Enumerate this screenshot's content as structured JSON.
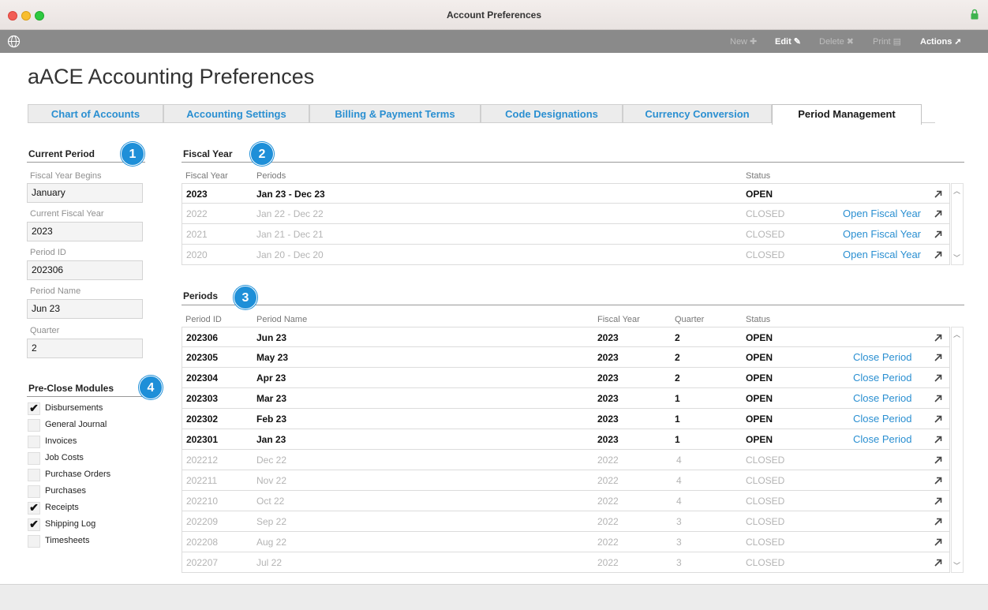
{
  "window": {
    "title": "Account Preferences"
  },
  "toolbar": {
    "new_label": "New",
    "edit_label": "Edit",
    "delete_label": "Delete",
    "print_label": "Print",
    "actions_label": "Actions",
    "icons": [
      "globe-icon",
      "plus-icon",
      "pencil-icon",
      "x-icon",
      "printer-icon",
      "goto-arrow-icon"
    ]
  },
  "page": {
    "title": "aACE Accounting Preferences"
  },
  "tabs": [
    {
      "label": "Chart of Accounts",
      "active": false
    },
    {
      "label": "Accounting Settings",
      "active": false
    },
    {
      "label": "Billing & Payment Terms",
      "active": false
    },
    {
      "label": "Code Designations",
      "active": false
    },
    {
      "label": "Currency Conversion",
      "active": false
    },
    {
      "label": "Period Management",
      "active": true
    }
  ],
  "badges": [
    "1",
    "2",
    "3",
    "4"
  ],
  "current_period": {
    "title": "Current Period",
    "fields": [
      {
        "label": "Fiscal Year Begins",
        "value": "January"
      },
      {
        "label": "Current Fiscal Year",
        "value": "2023"
      },
      {
        "label": "Period ID",
        "value": "202306"
      },
      {
        "label": "Period Name",
        "value": "Jun 23"
      },
      {
        "label": "Quarter",
        "value": "2"
      }
    ]
  },
  "pre_close": {
    "title": "Pre-Close Modules",
    "modules": [
      {
        "label": "Disbursements",
        "checked": true,
        "mark": "✔"
      },
      {
        "label": "General Journal",
        "checked": false,
        "mark": ""
      },
      {
        "label": "Invoices",
        "checked": false,
        "mark": ""
      },
      {
        "label": "Job Costs",
        "checked": false,
        "mark": ""
      },
      {
        "label": "Purchase Orders",
        "checked": false,
        "mark": ""
      },
      {
        "label": "Purchases",
        "checked": false,
        "mark": ""
      },
      {
        "label": "Receipts",
        "checked": true,
        "mark": "✔"
      },
      {
        "label": "Shipping Log",
        "checked": true,
        "mark": "✔"
      },
      {
        "label": "Timesheets",
        "checked": false,
        "mark": ""
      }
    ]
  },
  "fiscal_year": {
    "title": "Fiscal Year",
    "headers": {
      "fiscal_year": "Fiscal Year",
      "periods": "Periods",
      "status": "Status"
    },
    "rows": [
      {
        "year": "2023",
        "periods": "Jan 23 - Dec 23",
        "status": "OPEN",
        "action": ""
      },
      {
        "year": "2022",
        "periods": "Jan 22 - Dec 22",
        "status": "CLOSED",
        "action": "Open Fiscal Year"
      },
      {
        "year": "2021",
        "periods": "Jan 21 - Dec 21",
        "status": "CLOSED",
        "action": "Open Fiscal Year"
      },
      {
        "year": "2020",
        "periods": "Jan 20 - Dec 20",
        "status": "CLOSED",
        "action": "Open Fiscal Year"
      }
    ]
  },
  "periods": {
    "title": "Periods",
    "headers": {
      "period_id": "Period ID",
      "period_name": "Period Name",
      "fiscal_year": "Fiscal Year",
      "quarter": "Quarter",
      "status": "Status"
    },
    "rows": [
      {
        "id": "202306",
        "name": "Jun 23",
        "year": "2023",
        "quarter": "2",
        "status": "OPEN",
        "action": ""
      },
      {
        "id": "202305",
        "name": "May 23",
        "year": "2023",
        "quarter": "2",
        "status": "OPEN",
        "action": "Close Period"
      },
      {
        "id": "202304",
        "name": "Apr 23",
        "year": "2023",
        "quarter": "2",
        "status": "OPEN",
        "action": "Close Period"
      },
      {
        "id": "202303",
        "name": "Mar 23",
        "year": "2023",
        "quarter": "1",
        "status": "OPEN",
        "action": "Close Period"
      },
      {
        "id": "202302",
        "name": "Feb 23",
        "year": "2023",
        "quarter": "1",
        "status": "OPEN",
        "action": "Close Period"
      },
      {
        "id": "202301",
        "name": "Jan 23",
        "year": "2023",
        "quarter": "1",
        "status": "OPEN",
        "action": "Close Period"
      },
      {
        "id": "202212",
        "name": "Dec 22",
        "year": "2022",
        "quarter": "4",
        "status": "CLOSED",
        "action": ""
      },
      {
        "id": "202211",
        "name": "Nov 22",
        "year": "2022",
        "quarter": "4",
        "status": "CLOSED",
        "action": ""
      },
      {
        "id": "202210",
        "name": "Oct 22",
        "year": "2022",
        "quarter": "4",
        "status": "CLOSED",
        "action": ""
      },
      {
        "id": "202209",
        "name": "Sep 22",
        "year": "2022",
        "quarter": "3",
        "status": "CLOSED",
        "action": ""
      },
      {
        "id": "202208",
        "name": "Aug 22",
        "year": "2022",
        "quarter": "3",
        "status": "CLOSED",
        "action": ""
      },
      {
        "id": "202207",
        "name": "Jul 22",
        "year": "2022",
        "quarter": "3",
        "status": "CLOSED",
        "action": ""
      }
    ]
  },
  "colors": {
    "accent": "#2a8fd1",
    "badge": "#1e8fd8",
    "toolbar": "#8a8a8a"
  }
}
